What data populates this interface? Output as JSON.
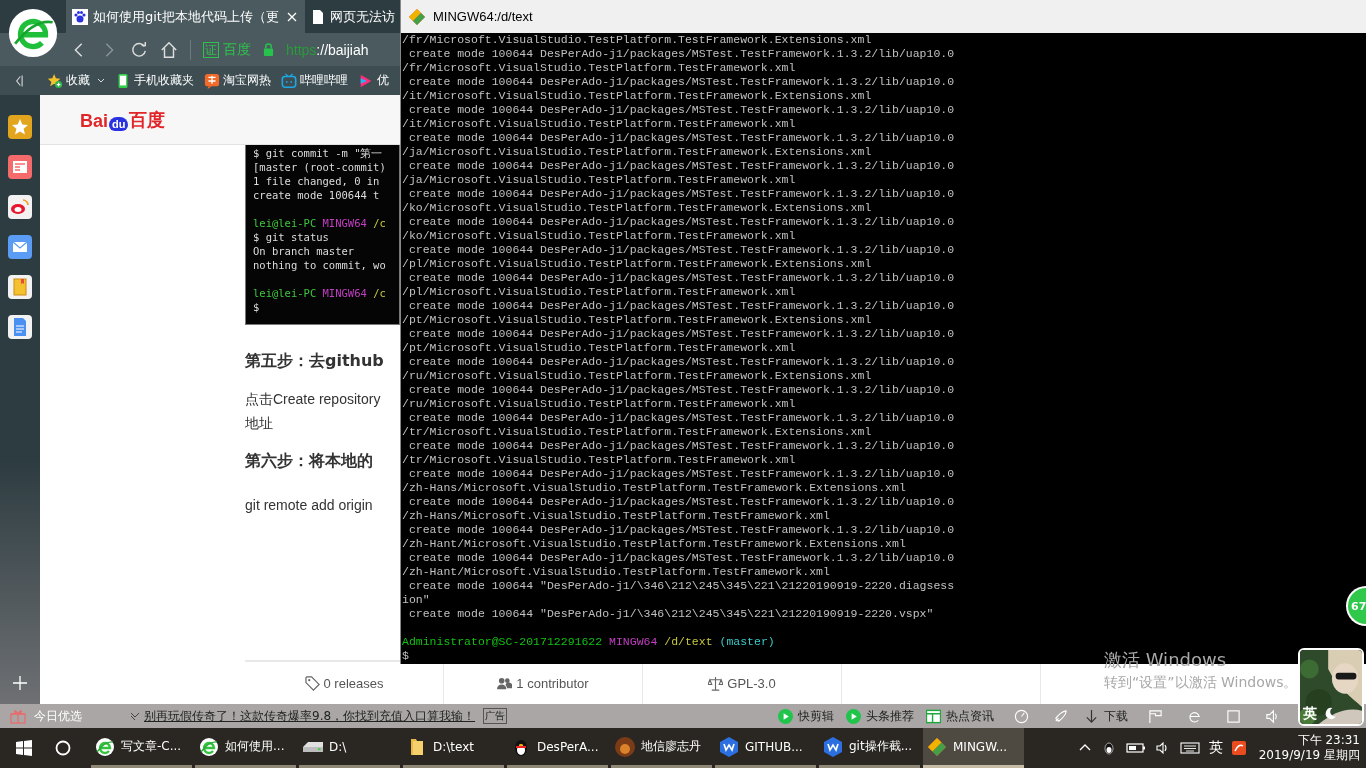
{
  "browser": {
    "tabs": [
      {
        "title": "如何使用git把本地代码上传（更",
        "kind": "paw",
        "selected": true
      },
      {
        "title": "网页无法访",
        "kind": "page",
        "selected": false
      }
    ],
    "address": {
      "cert": "证",
      "site": "百度",
      "scheme": "https",
      "rest": "://baijiah"
    },
    "bookmarks": [
      {
        "label": "收藏",
        "kind": "star"
      },
      {
        "label": "手机收藏夹",
        "kind": "phone"
      },
      {
        "label": "淘宝网热",
        "kind": "tao"
      },
      {
        "label": "哔哩哔哩",
        "kind": "tv"
      },
      {
        "label": "优",
        "kind": "youku"
      }
    ],
    "page": {
      "logo": {
        "left": "Bai",
        "paw": "du",
        "right": "百度"
      },
      "image_lines": [
        {
          "kind": "text",
          "text": "$ git commit -m \"第一"
        },
        {
          "kind": "text",
          "text": "[master (root-commit)"
        },
        {
          "kind": "text",
          "text": " 1 file changed, 0 in"
        },
        {
          "kind": "text",
          "text": " create mode 100644 t"
        },
        {
          "kind": "blank"
        },
        {
          "kind": "prompt",
          "user": "lei@lei-PC",
          "host": "MINGW64",
          "path": "/c"
        },
        {
          "kind": "text",
          "text": "$ git status"
        },
        {
          "kind": "text",
          "text": "On branch master"
        },
        {
          "kind": "text",
          "text": "nothing to commit, wo"
        },
        {
          "kind": "blank"
        },
        {
          "kind": "prompt",
          "user": "lei@lei-PC",
          "host": "MINGW64",
          "path": "/c"
        },
        {
          "kind": "text",
          "text": "$"
        }
      ],
      "heading_1": "第五步：去github",
      "paragraph_lines": [
        "点击Create repository",
        "地址"
      ],
      "heading_2": "第六步：将本地的",
      "code": "git remote add origin",
      "stats": [
        {
          "label": "0 releases",
          "kind": "tag"
        },
        {
          "label": "1 contributor",
          "kind": "people"
        },
        {
          "label": "GPL-3.0",
          "kind": "scale"
        }
      ]
    },
    "bottom_bar": {
      "promo": "今日优选",
      "ad": "别再玩假传奇了！这款传奇爆率9.8，你找到充值入口算我输！",
      "ad_tag": "广告",
      "items": [
        {
          "label": "快剪辑",
          "kind": "play"
        },
        {
          "label": "头条推荐",
          "kind": "play"
        },
        {
          "label": "热点资讯",
          "kind": "news"
        }
      ],
      "download": "下载"
    }
  },
  "terminal": {
    "title": "MINGW64:/d/text",
    "lines": [
      "/fr/Microsoft.VisualStudio.TestPlatform.TestFramework.Extensions.xml",
      " create mode 100644 DesPerAdo-j1/packages/MSTest.TestFramework.1.3.2/lib/uap10.0",
      "/fr/Microsoft.VisualStudio.TestPlatform.TestFramework.xml",
      " create mode 100644 DesPerAdo-j1/packages/MSTest.TestFramework.1.3.2/lib/uap10.0",
      "/it/Microsoft.VisualStudio.TestPlatform.TestFramework.Extensions.xml",
      " create mode 100644 DesPerAdo-j1/packages/MSTest.TestFramework.1.3.2/lib/uap10.0",
      "/it/Microsoft.VisualStudio.TestPlatform.TestFramework.xml",
      " create mode 100644 DesPerAdo-j1/packages/MSTest.TestFramework.1.3.2/lib/uap10.0",
      "/ja/Microsoft.VisualStudio.TestPlatform.TestFramework.Extensions.xml",
      " create mode 100644 DesPerAdo-j1/packages/MSTest.TestFramework.1.3.2/lib/uap10.0",
      "/ja/Microsoft.VisualStudio.TestPlatform.TestFramework.xml",
      " create mode 100644 DesPerAdo-j1/packages/MSTest.TestFramework.1.3.2/lib/uap10.0",
      "/ko/Microsoft.VisualStudio.TestPlatform.TestFramework.Extensions.xml",
      " create mode 100644 DesPerAdo-j1/packages/MSTest.TestFramework.1.3.2/lib/uap10.0",
      "/ko/Microsoft.VisualStudio.TestPlatform.TestFramework.xml",
      " create mode 100644 DesPerAdo-j1/packages/MSTest.TestFramework.1.3.2/lib/uap10.0",
      "/pl/Microsoft.VisualStudio.TestPlatform.TestFramework.Extensions.xml",
      " create mode 100644 DesPerAdo-j1/packages/MSTest.TestFramework.1.3.2/lib/uap10.0",
      "/pl/Microsoft.VisualStudio.TestPlatform.TestFramework.xml",
      " create mode 100644 DesPerAdo-j1/packages/MSTest.TestFramework.1.3.2/lib/uap10.0",
      "/pt/Microsoft.VisualStudio.TestPlatform.TestFramework.Extensions.xml",
      " create mode 100644 DesPerAdo-j1/packages/MSTest.TestFramework.1.3.2/lib/uap10.0",
      "/pt/Microsoft.VisualStudio.TestPlatform.TestFramework.xml",
      " create mode 100644 DesPerAdo-j1/packages/MSTest.TestFramework.1.3.2/lib/uap10.0",
      "/ru/Microsoft.VisualStudio.TestPlatform.TestFramework.Extensions.xml",
      " create mode 100644 DesPerAdo-j1/packages/MSTest.TestFramework.1.3.2/lib/uap10.0",
      "/ru/Microsoft.VisualStudio.TestPlatform.TestFramework.xml",
      " create mode 100644 DesPerAdo-j1/packages/MSTest.TestFramework.1.3.2/lib/uap10.0",
      "/tr/Microsoft.VisualStudio.TestPlatform.TestFramework.Extensions.xml",
      " create mode 100644 DesPerAdo-j1/packages/MSTest.TestFramework.1.3.2/lib/uap10.0",
      "/tr/Microsoft.VisualStudio.TestPlatform.TestFramework.xml",
      " create mode 100644 DesPerAdo-j1/packages/MSTest.TestFramework.1.3.2/lib/uap10.0",
      "/zh-Hans/Microsoft.VisualStudio.TestPlatform.TestFramework.Extensions.xml",
      " create mode 100644 DesPerAdo-j1/packages/MSTest.TestFramework.1.3.2/lib/uap10.0",
      "/zh-Hans/Microsoft.VisualStudio.TestPlatform.TestFramework.xml",
      " create mode 100644 DesPerAdo-j1/packages/MSTest.TestFramework.1.3.2/lib/uap10.0",
      "/zh-Hant/Microsoft.VisualStudio.TestPlatform.TestFramework.Extensions.xml",
      " create mode 100644 DesPerAdo-j1/packages/MSTest.TestFramework.1.3.2/lib/uap10.0",
      "/zh-Hant/Microsoft.VisualStudio.TestPlatform.TestFramework.xml",
      " create mode 100644 \"DesPerAdo-j1/\\346\\212\\245\\345\\221\\21220190919-2220.diagsess",
      "ion\"",
      " create mode 100644 \"DesPerAdo-j1/\\346\\212\\245\\345\\221\\21220190919-2220.vspx\""
    ],
    "prompt": {
      "user": "Administrator@SC-201712291622",
      "host": "MINGW64",
      "path": "/d/text",
      "branch": "(master)"
    },
    "cursor": "$"
  },
  "activation": {
    "title": "激活 Windows",
    "hint": "转到“设置”以激活 Windows。"
  },
  "floating_ball": "67",
  "avatar_ime": "英",
  "taskbar": {
    "items": [
      {
        "label": "写文章-C...",
        "kind": "ie",
        "selected": false
      },
      {
        "label": "如何使用...",
        "kind": "ie",
        "selected": false
      },
      {
        "label": "D:\\",
        "kind": "drive",
        "selected": false
      },
      {
        "label": "D:\\text",
        "kind": "folder",
        "selected": false
      },
      {
        "label": "DesPerA...",
        "kind": "qq",
        "selected": false
      },
      {
        "label": "地信廖志丹",
        "kind": "avatar",
        "selected": false
      },
      {
        "label": "GITHUB...",
        "kind": "wps",
        "selected": false
      },
      {
        "label": "git操作截...",
        "kind": "wps",
        "selected": false
      },
      {
        "label": "MINGW...",
        "kind": "git",
        "selected": true
      }
    ],
    "ime": "英",
    "time": "下午 23:31",
    "date": "2019/9/19 星期四"
  }
}
